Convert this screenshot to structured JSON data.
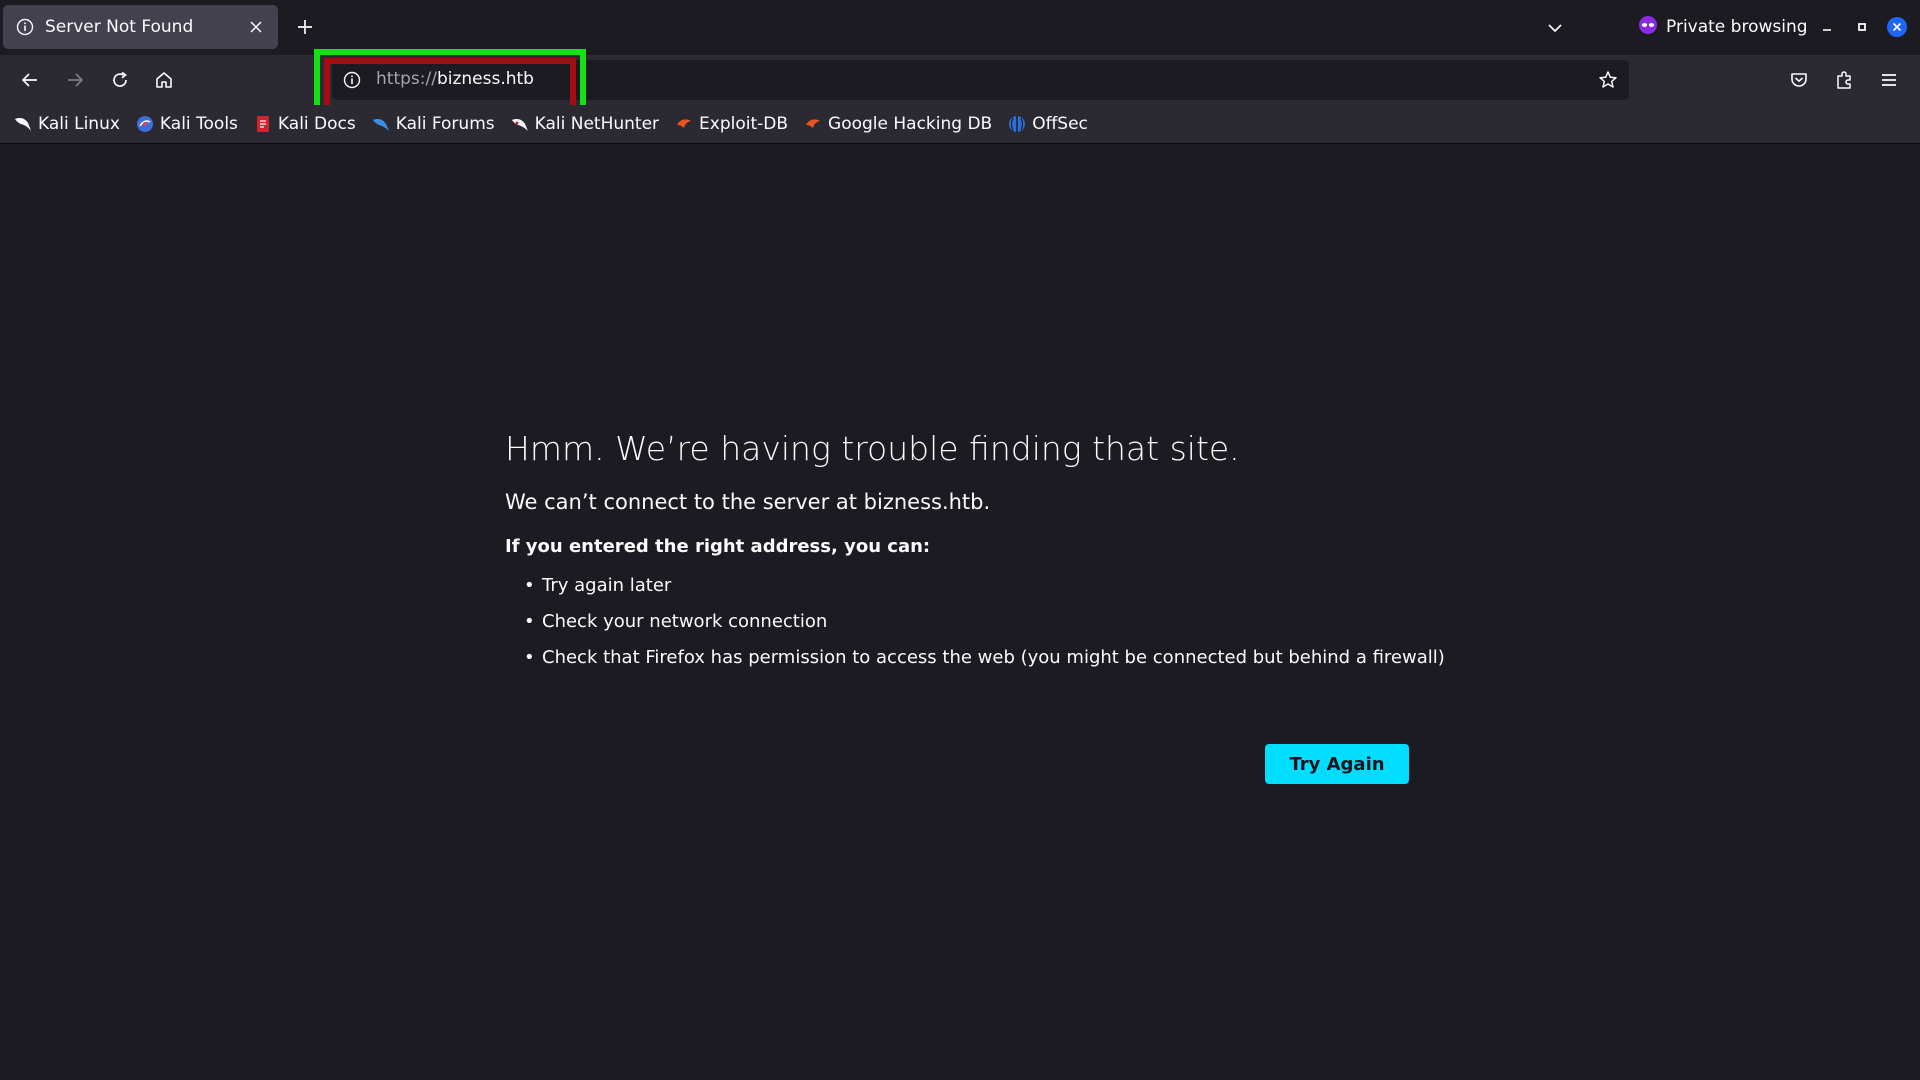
{
  "tab": {
    "title": "Server Not Found",
    "icon": "info-icon"
  },
  "window": {
    "private_label": "Private browsing"
  },
  "urlbar": {
    "scheme": "https://",
    "host": "bizness.htb"
  },
  "bookmarks": [
    {
      "label": "Kali Linux",
      "icon": "kali-dragon-icon"
    },
    {
      "label": "Kali Tools",
      "icon": "kali-tools-icon"
    },
    {
      "label": "Kali Docs",
      "icon": "kali-docs-icon"
    },
    {
      "label": "Kali Forums",
      "icon": "kali-forums-icon"
    },
    {
      "label": "Kali NetHunter",
      "icon": "kali-nethunter-icon"
    },
    {
      "label": "Exploit-DB",
      "icon": "exploit-db-icon"
    },
    {
      "label": "Google Hacking DB",
      "icon": "ghdb-icon"
    },
    {
      "label": "OffSec",
      "icon": "offsec-icon"
    }
  ],
  "error": {
    "title": "Hmm. We’re having trouble finding that site.",
    "description": "We can’t connect to the server at bizness.htb.",
    "lead": "If you entered the right address, you can:",
    "items": [
      "Try again later",
      "Check your network connection",
      "Check that Firefox has permission to access the web (you might be connected but behind a firewall)"
    ],
    "button_label": "Try Again"
  },
  "colors": {
    "accent": "#00ddff",
    "highlight_outer": "#16e016",
    "highlight_inner": "#a60d13",
    "background": "#1c1b22",
    "toolbar": "#2b2a33"
  }
}
